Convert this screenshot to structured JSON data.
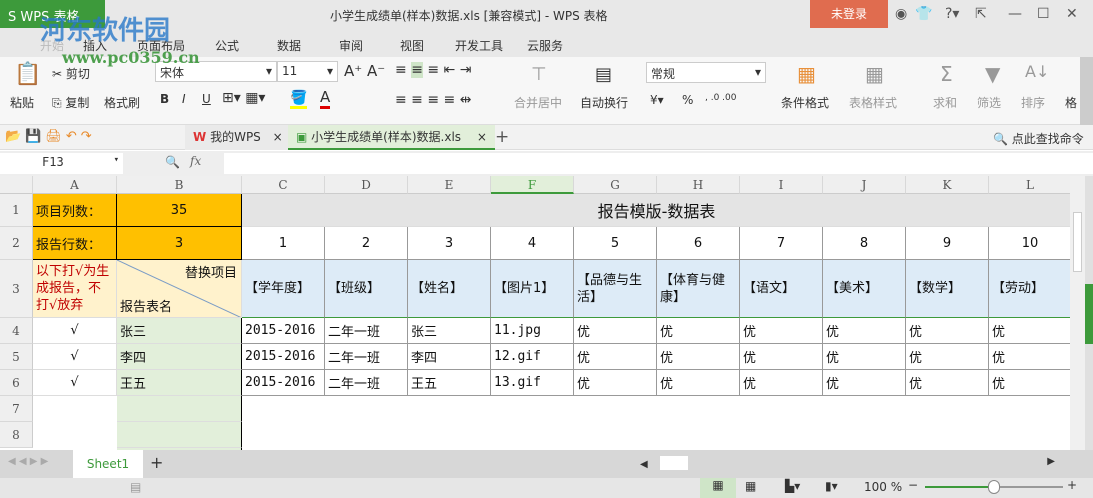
{
  "window": {
    "app_label": "S WPS 表格",
    "title": "小学生成绩单(样本)数据.xls [兼容模式] - WPS 表格",
    "login": "未登录",
    "watermark": "河东软件园",
    "watermark_url": "www.pc0359.cn"
  },
  "menu": [
    "开始",
    "插入",
    "页面布局",
    "公式",
    "数据",
    "审阅",
    "视图",
    "开发工具",
    "云服务"
  ],
  "ribbon": {
    "paste": "粘贴",
    "cut": "剪切",
    "copy": "复制",
    "format_painter": "格式刷",
    "font": "宋体",
    "font_size": "11",
    "bold": "B",
    "italic": "I",
    "underline": "U",
    "merge": "合并居中",
    "wrap": "自动换行",
    "number_format": "常规",
    "percent": "%",
    "cond_format": "条件格式",
    "table_style": "表格样式",
    "sum": "求和",
    "filter": "筛选",
    "sort": "排序",
    "format": "格"
  },
  "tabs": {
    "my_wps": "我的WPS",
    "file": "小学生成绩单(样本)数据.xls",
    "search": "点此查找命令"
  },
  "formula": {
    "cell_ref": "F13",
    "value": ""
  },
  "columns": [
    "A",
    "B",
    "C",
    "D",
    "E",
    "F",
    "G",
    "H",
    "I",
    "J",
    "K",
    "L"
  ],
  "rows": [
    "1",
    "2",
    "3",
    "4",
    "5",
    "6",
    "7",
    "8"
  ],
  "cells": {
    "r1": {
      "A": "项目列数：",
      "B": "35",
      "title": "报告模版-数据表"
    },
    "r2": {
      "A": "报告行数：",
      "B": "3",
      "nums": [
        "1",
        "2",
        "3",
        "4",
        "5",
        "6",
        "7",
        "8",
        "9",
        "10"
      ]
    },
    "r3": {
      "A": "以下打√为生成报告，不打√放弃",
      "B_top": "替换项目",
      "B_bottom": "报告表名",
      "headers": [
        "【学年度】",
        "【班级】",
        "【姓名】",
        "【图片1】",
        "【品德与生活】",
        "【体育与健康】",
        "【语文】",
        "【美术】",
        "【数学】",
        "【劳动】"
      ]
    },
    "data": [
      {
        "A": "√",
        "B": "张三",
        "vals": [
          "2015-2016",
          "二年一班",
          "张三",
          "11.jpg",
          "优",
          "优",
          "优",
          "优",
          "优",
          "优"
        ]
      },
      {
        "A": "√",
        "B": "李四",
        "vals": [
          "2015-2016",
          "二年一班",
          "李四",
          "12.gif",
          "优",
          "优",
          "优",
          "优",
          "优",
          "优"
        ]
      },
      {
        "A": "√",
        "B": "王五",
        "vals": [
          "2015-2016",
          "二年一班",
          "王五",
          "13.gif",
          "优",
          "优",
          "优",
          "优",
          "优",
          "优"
        ]
      }
    ]
  },
  "sheets": [
    "Sheet1"
  ],
  "status": {
    "zoom": "100 %",
    "zoom_level": 0.5
  },
  "colors": {
    "accent": "#3d9a3b",
    "login": "#e06c4f",
    "orange": "#ffc000",
    "blue_header": "#ddebf7",
    "green_cell": "#e2efda",
    "cream": "#fff2cc",
    "red_text": "#c00000"
  }
}
